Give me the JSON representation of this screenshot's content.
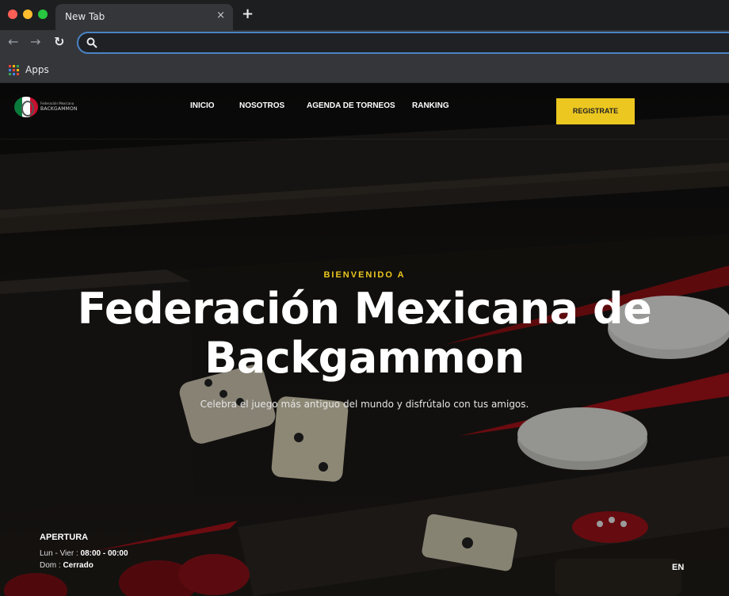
{
  "browser": {
    "tab_title": "New Tab",
    "tab_close_icon": "×",
    "new_tab_icon": "+",
    "back_icon": "←",
    "forward_icon": "→",
    "reload_icon": "↻",
    "address_value": "",
    "bookmarks": {
      "apps_label": "Apps"
    },
    "colors": {
      "traffic_red": "#fe5f57",
      "traffic_yellow": "#febc2e",
      "traffic_green": "#28c840",
      "omnibox_focus": "#4a84c4"
    }
  },
  "site": {
    "logo": {
      "small_text": "Federación Mexicana",
      "main_text": "BACKGAMMON"
    },
    "nav": [
      {
        "label": "INICIO"
      },
      {
        "label": "NOSOTROS"
      },
      {
        "label": "AGENDA DE TORNEOS"
      },
      {
        "label": "RANKING"
      }
    ],
    "cta_label": "REGISTRATE",
    "accent_color": "#ecc720",
    "hero": {
      "kicker": "BIENVENIDO A",
      "title_line1": "Federación Mexicana de",
      "title_line2": "Backgammon",
      "subtitle": "Celebra el juego más antiguo del mundo y disfrútalo con tus amigos."
    },
    "hours": {
      "title": "APERTURA",
      "weekday_label": "Lun - Vier :",
      "weekday_value": "08:00 - 00:00",
      "sunday_label": "Dom :",
      "sunday_value": "Cerrado"
    },
    "language": "EN"
  }
}
